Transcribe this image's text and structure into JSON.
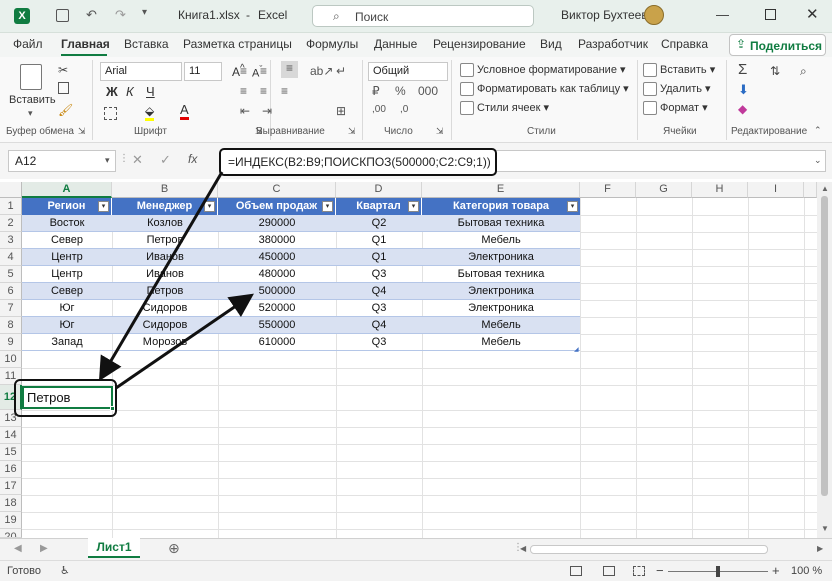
{
  "titlebar": {
    "filename": "Книга1.xlsx",
    "app": "Excel",
    "search": "Поиск",
    "user": "Виктор Бухтеев"
  },
  "tabs": [
    "Файл",
    "Главная",
    "Вставка",
    "Разметка страницы",
    "Формулы",
    "Данные",
    "Рецензирование",
    "Вид",
    "Разработчик",
    "Справка"
  ],
  "share_label": "Поделиться",
  "ribbon": {
    "paste": "Вставить",
    "font_name": "Arial",
    "font_size": "11",
    "number_format": "Общий",
    "cond_format": "Условное форматирование",
    "format_table": "Форматировать как таблицу",
    "cell_styles": "Стили ячеек",
    "insert": "Вставить",
    "delete": "Удалить",
    "format": "Формат",
    "groups": [
      "Буфер обмена",
      "Шрифт",
      "Выравнивание",
      "Число",
      "Стили",
      "Ячейки",
      "Редактирование"
    ]
  },
  "namebox": "A12",
  "formula": "=ИНДЕКС(B2:B9;ПОИСКПОЗ(500000;C2:C9;1))",
  "columns": [
    "A",
    "B",
    "C",
    "D",
    "E",
    "F",
    "G",
    "H",
    "I"
  ],
  "rows": [
    "1",
    "2",
    "3",
    "4",
    "5",
    "6",
    "7",
    "8",
    "9",
    "10",
    "11",
    "12",
    "13",
    "14",
    "15",
    "16",
    "17",
    "18",
    "19",
    "20"
  ],
  "table": {
    "headers": [
      "Регион",
      "Менеджер",
      "Объем продаж",
      "Квартал",
      "Категория товара"
    ],
    "rows": [
      [
        "Восток",
        "Козлов",
        "290000",
        "Q2",
        "Бытовая техника"
      ],
      [
        "Север",
        "Петров",
        "380000",
        "Q1",
        "Мебель"
      ],
      [
        "Центр",
        "Иванов",
        "450000",
        "Q1",
        "Электроника"
      ],
      [
        "Центр",
        "Иванов",
        "480000",
        "Q3",
        "Бытовая техника"
      ],
      [
        "Север",
        "Петров",
        "500000",
        "Q4",
        "Электроника"
      ],
      [
        "Юг",
        "Сидоров",
        "520000",
        "Q3",
        "Электроника"
      ],
      [
        "Юг",
        "Сидоров",
        "550000",
        "Q4",
        "Мебель"
      ],
      [
        "Запад",
        "Морозов",
        "610000",
        "Q3",
        "Мебель"
      ]
    ]
  },
  "result_cell": "Петров",
  "sheet_tab": "Лист1",
  "status": {
    "ready": "Готово",
    "zoom": "100 %"
  },
  "colors": {
    "accent": "#107c41",
    "table_header": "#4472c4",
    "band": "#d9e1f2"
  }
}
